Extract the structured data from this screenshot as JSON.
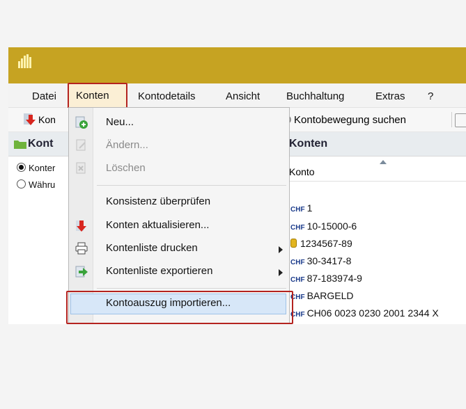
{
  "menubar": {
    "items": [
      {
        "label": "Datei"
      },
      {
        "label": "Konten"
      },
      {
        "label": "Kontodetails"
      },
      {
        "label": "Ansicht"
      },
      {
        "label": "Buchhaltung"
      },
      {
        "label": "Extras"
      },
      {
        "label": "?"
      }
    ]
  },
  "toolbar": {
    "first_button_label": "Kon",
    "search_label": "Kontobewegung suchen"
  },
  "left_pane": {
    "title": "Kont",
    "options": [
      {
        "label": "Konter",
        "selected": true
      },
      {
        "label": "Währu",
        "selected": false
      }
    ]
  },
  "right_pane": {
    "title": "Konten",
    "column": "Konto",
    "currency_tag": "CHF",
    "rows": [
      "1",
      "10-15000-6",
      "1234567-89",
      "30-3417-8",
      "87-183974-9",
      "BARGELD",
      "CH06 0023 0230 2001 2344 X"
    ]
  },
  "dropdown": {
    "items": [
      {
        "label": "Neu...",
        "icon": "add-icon",
        "disabled": false
      },
      {
        "label": "Ändern...",
        "icon": "edit-icon",
        "disabled": true
      },
      {
        "label": "Löschen",
        "icon": "delete-icon",
        "disabled": true
      },
      {
        "label": "Konsistenz überprüfen",
        "icon": "",
        "disabled": false
      },
      {
        "label": "Konten aktualisieren...",
        "icon": "update-arrow-icon",
        "disabled": false
      },
      {
        "label": "Kontenliste drucken",
        "icon": "printer-icon",
        "disabled": false,
        "submenu": true
      },
      {
        "label": "Kontenliste exportieren",
        "icon": "export-icon",
        "disabled": false,
        "submenu": true
      },
      {
        "label": "Kontoauszug importieren...",
        "icon": "",
        "disabled": false,
        "highlighted": true
      }
    ]
  },
  "colors": {
    "titlebar": "#c6a322",
    "highlight_box": "#b4231f",
    "menu_hover": "#d7e7f8"
  }
}
